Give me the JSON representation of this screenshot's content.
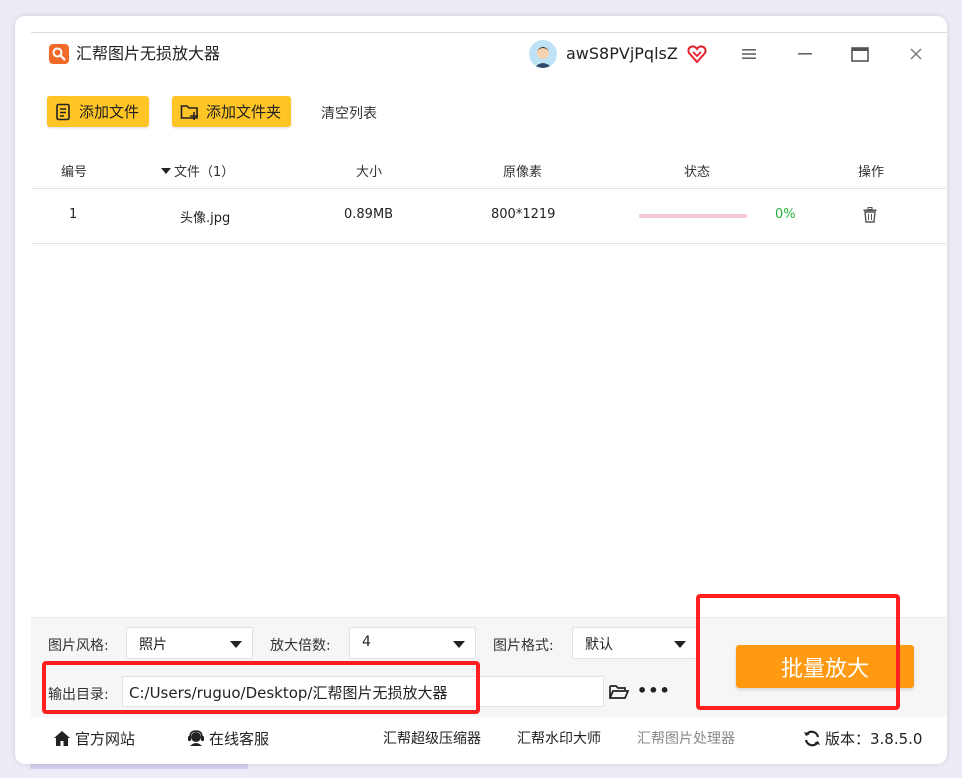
{
  "app": {
    "title": "汇帮图片无损放大器",
    "username": "awS8PVjPqlsZ"
  },
  "toolbar": {
    "add_file": "添加文件",
    "add_folder": "添加文件夹",
    "clear_list": "清空列表"
  },
  "table": {
    "headers": {
      "index": "编号",
      "file": "文件（1）",
      "size": "大小",
      "pixels": "原像素",
      "status": "状态",
      "action": "操作"
    },
    "rows": [
      {
        "index": "1",
        "file": "头像.jpg",
        "size": "0.89MB",
        "pixels": "800*1219",
        "progress_pct": "0%",
        "progress_fraction": 0
      }
    ]
  },
  "settings": {
    "style_label": "图片风格:",
    "style_value": "照片",
    "scale_label": "放大倍数:",
    "scale_value": "4",
    "format_label": "图片格式:",
    "format_value": "默认",
    "output_label": "输出目录:",
    "output_value": "C:/Users/ruguo/Desktop/汇帮图片无损放大器",
    "batch_button": "批量放大"
  },
  "footer": {
    "website": "官方网站",
    "support": "在线客服",
    "compressor": "汇帮超级压缩器",
    "watermark": "汇帮水印大师",
    "processor": "汇帮图片处理器",
    "version": "版本：3.8.5.0"
  },
  "colors": {
    "accent_yellow": "#ffc425",
    "accent_orange": "#ff9a12",
    "progress_pink": "#f6c9d6",
    "success_green": "#26b33a",
    "highlight_red": "#ff1f1f"
  },
  "icons": [
    "app-logo-icon",
    "avatar",
    "vip-heart-icon",
    "menu-icon",
    "minimize-icon",
    "maximize-icon",
    "close-icon",
    "add-file-icon",
    "add-folder-icon",
    "sort-arrow-icon",
    "trash-icon",
    "folder-open-icon",
    "more-icon",
    "home-icon",
    "support-icon",
    "refresh-icon"
  ]
}
